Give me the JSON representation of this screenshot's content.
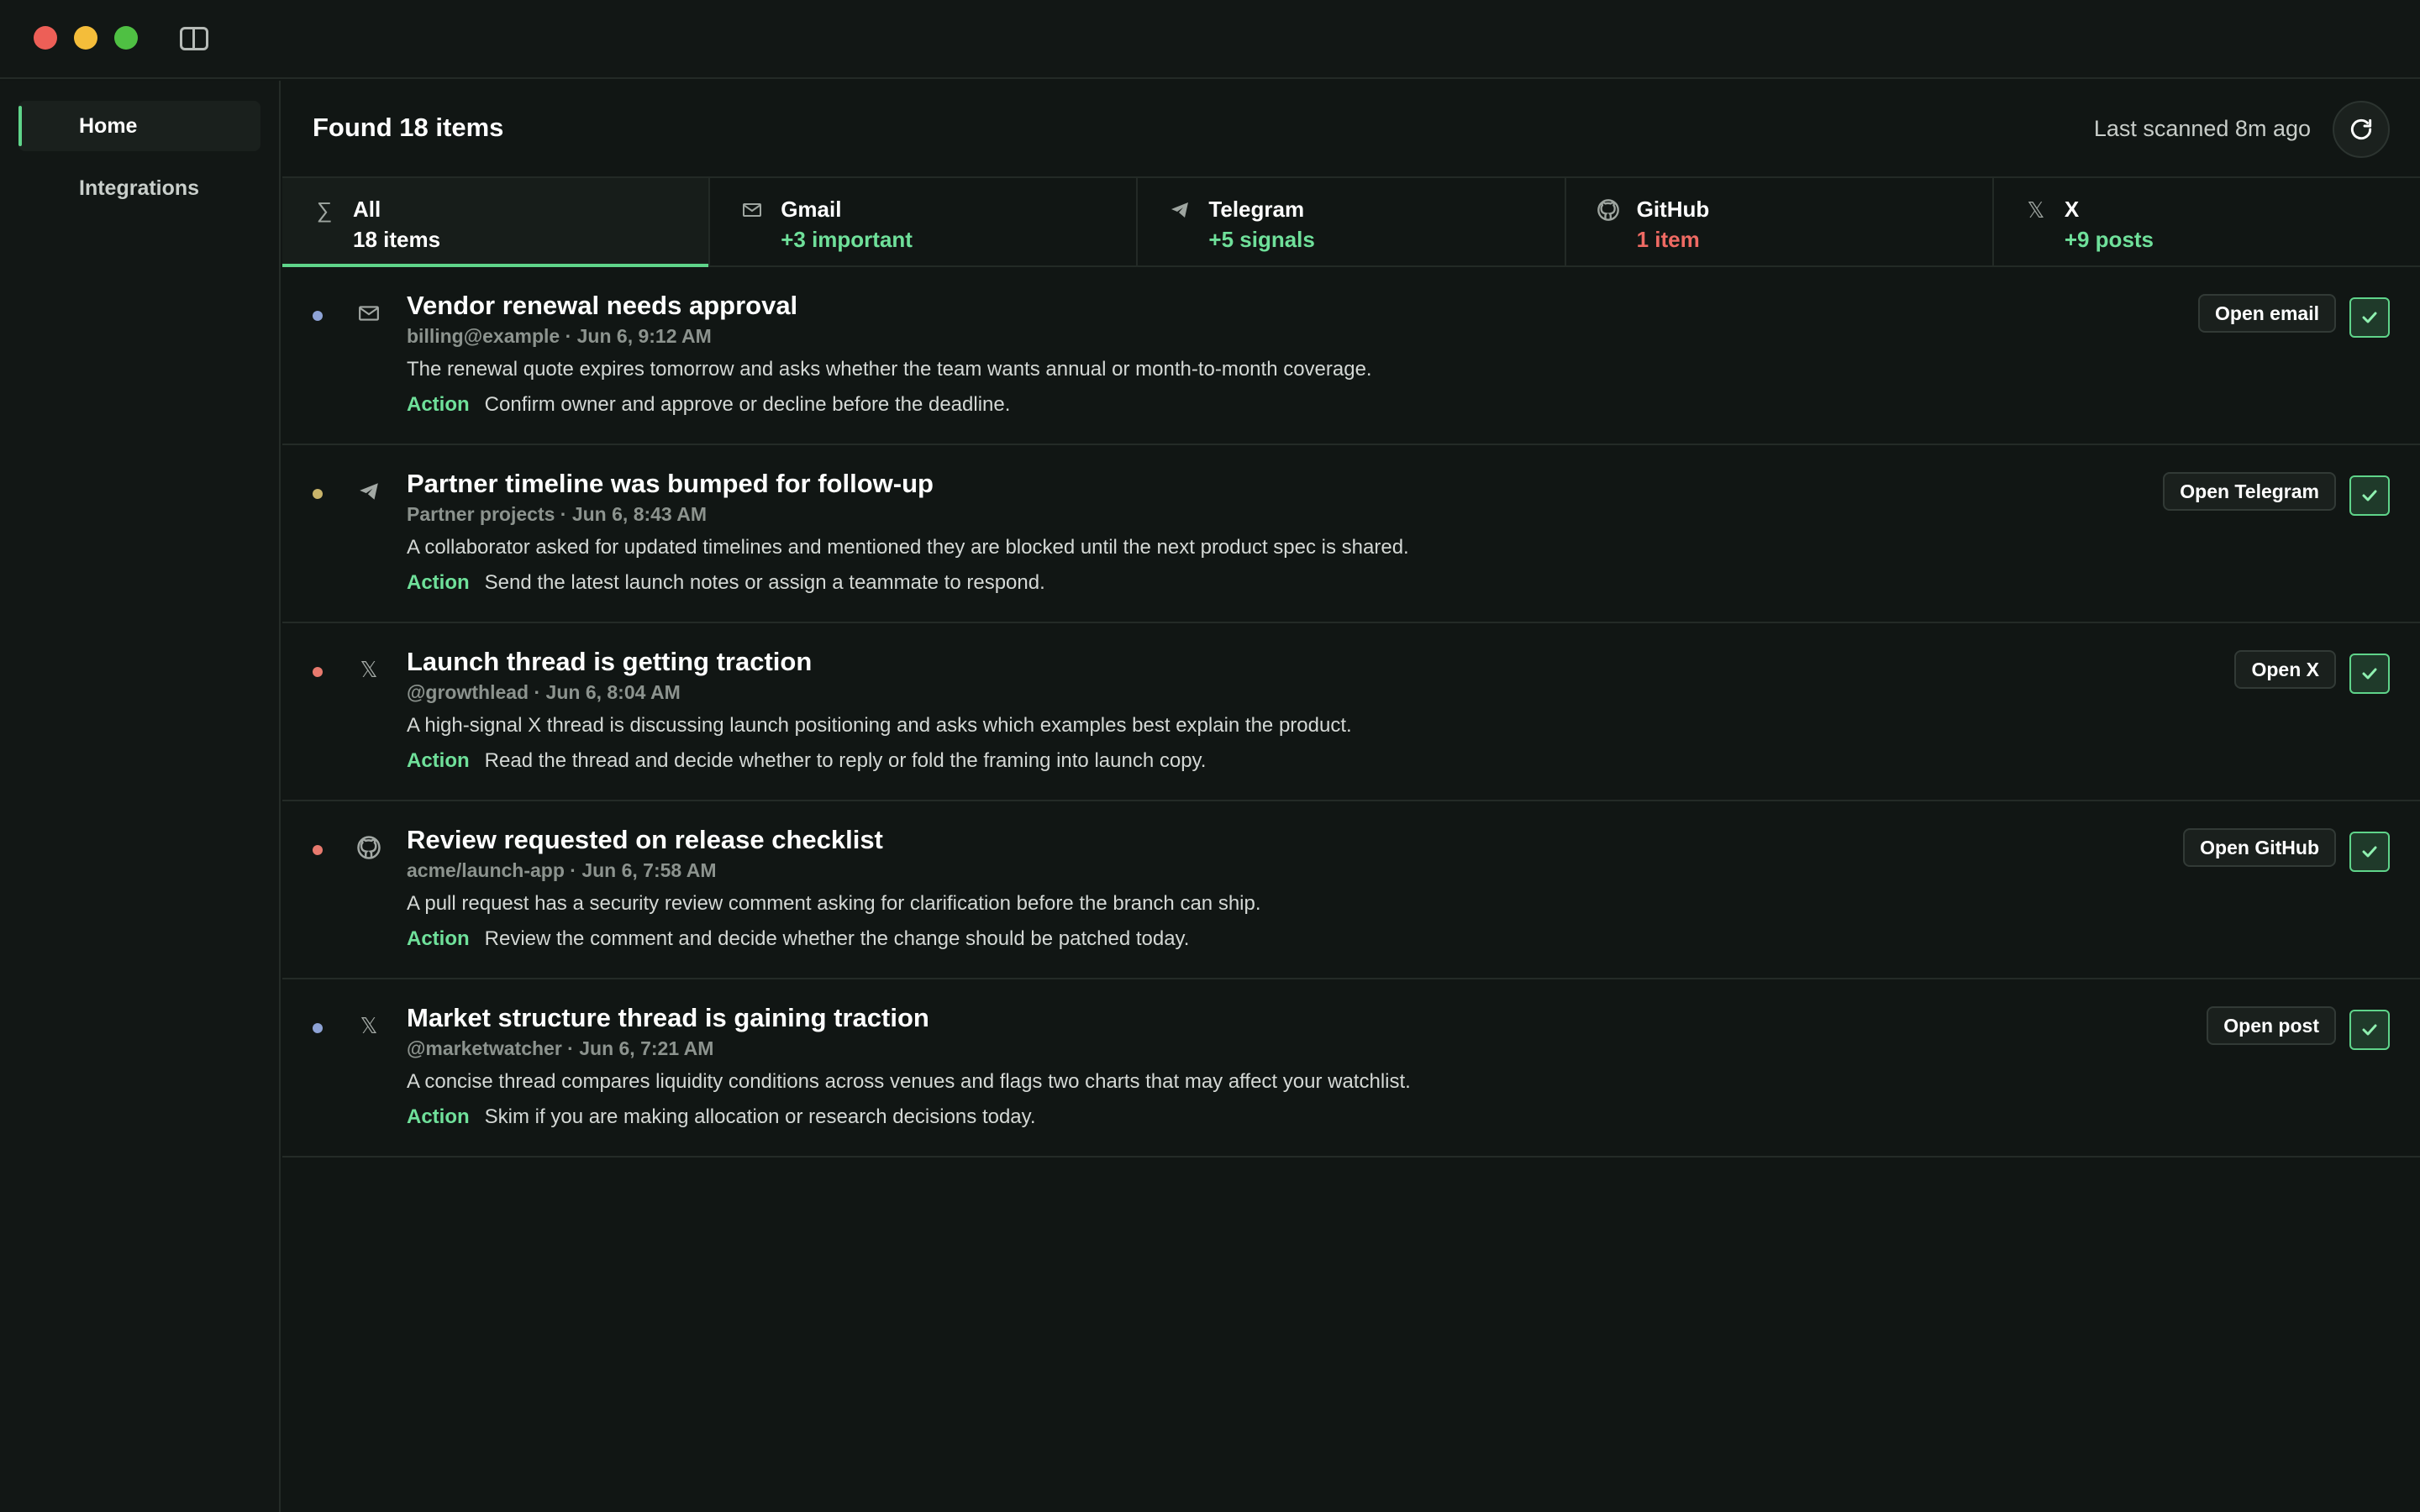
{
  "sidebar": {
    "items": [
      {
        "label": "Home",
        "active": true
      },
      {
        "label": "Integrations",
        "active": false
      }
    ]
  },
  "header": {
    "title": "Found 18 items",
    "last_scanned": "Last scanned 8m ago",
    "refresh_icon": "refresh-icon"
  },
  "tabs": [
    {
      "icon": "sigma-icon",
      "label": "All",
      "count": "18 items",
      "count_color": "#ffffff",
      "active": true
    },
    {
      "icon": "mail-icon",
      "label": "Gmail",
      "count": "+3 important",
      "count_color": "#6fe09a",
      "active": false
    },
    {
      "icon": "telegram-icon",
      "label": "Telegram",
      "count": "+5 signals",
      "count_color": "#6fe09a",
      "active": false
    },
    {
      "icon": "github-icon",
      "label": "GitHub",
      "count": "1 item",
      "count_color": "#ef6a63",
      "active": false
    },
    {
      "icon": "x-icon",
      "label": "X",
      "count": "+9 posts",
      "count_color": "#6fe09a",
      "active": false
    }
  ],
  "action_label": "Action",
  "items": [
    {
      "dot_color": "#8ea3d6",
      "icon": "mail-icon",
      "title": "Vendor renewal needs approval",
      "meta": "billing@example · Jun 6, 9:12 AM",
      "description": "The renewal quote expires tomorrow and asks whether the team wants annual or month-to-month coverage.",
      "action": "Confirm owner and approve or decline before the deadline.",
      "open_label": "Open email"
    },
    {
      "dot_color": "#c9b46a",
      "icon": "telegram-icon",
      "title": "Partner timeline was bumped for follow-up",
      "meta": "Partner projects · Jun 6, 8:43 AM",
      "description": "A collaborator asked for updated timelines and mentioned they are blocked until the next product spec is shared.",
      "action": "Send the latest launch notes or assign a teammate to respond.",
      "open_label": "Open Telegram"
    },
    {
      "dot_color": "#e87a6e",
      "icon": "x-icon",
      "title": "Launch thread is getting traction",
      "meta": "@growthlead · Jun 6, 8:04 AM",
      "description": "A high-signal X thread is discussing launch positioning and asks which examples best explain the product.",
      "action": "Read the thread and decide whether to reply or fold the framing into launch copy.",
      "open_label": "Open X"
    },
    {
      "dot_color": "#e87a6e",
      "icon": "github-icon",
      "title": "Review requested on release checklist",
      "meta": "acme/launch-app · Jun 6, 7:58 AM",
      "description": "A pull request has a security review comment asking for clarification before the branch can ship.",
      "action": "Review the comment and decide whether the change should be patched today.",
      "open_label": "Open GitHub"
    },
    {
      "dot_color": "#8ea3d6",
      "icon": "x-icon",
      "title": "Market structure thread is gaining traction",
      "meta": "@marketwatcher · Jun 6, 7:21 AM",
      "description": "A concise thread compares liquidity conditions across venues and flags two charts that may affect your watchlist.",
      "action": "Skim if you are making allocation or research decisions today.",
      "open_label": "Open post"
    }
  ],
  "colors": {
    "accent": "#5fd48a",
    "background": "#111614",
    "positive": "#6fe09a",
    "negative": "#ef6a63"
  }
}
